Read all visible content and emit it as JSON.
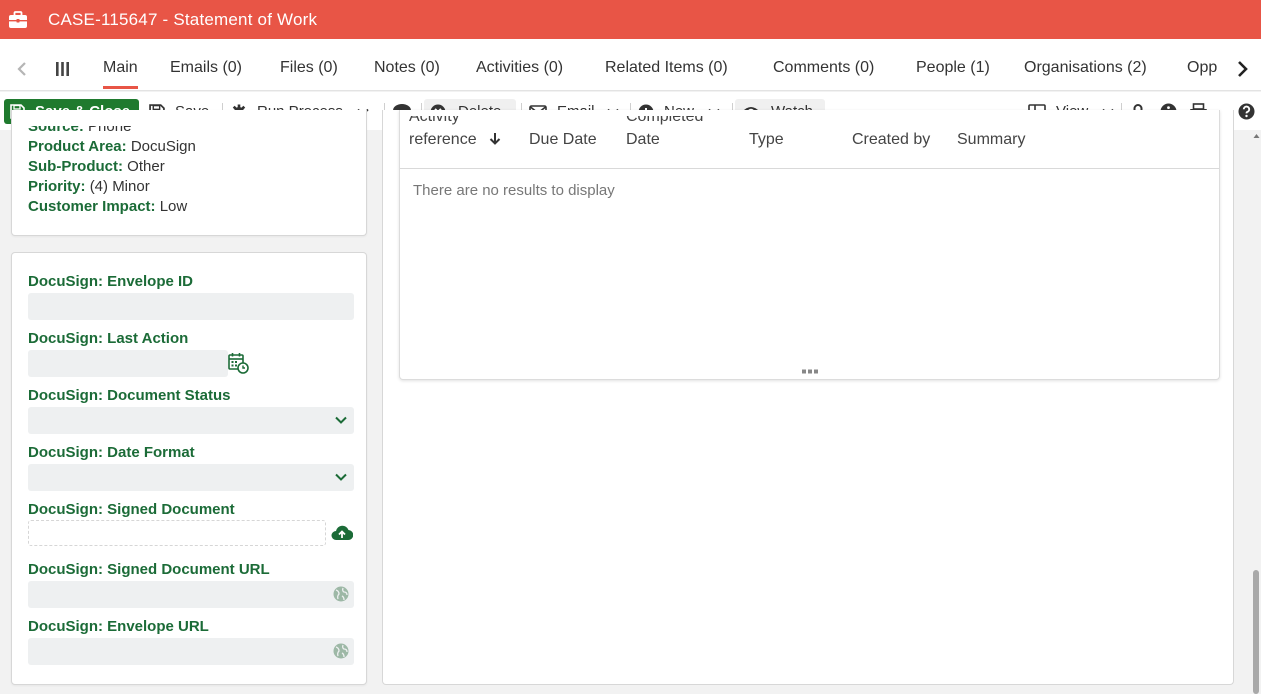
{
  "window": {
    "title": "CASE-115647 - Statement of Work",
    "title_icon": "briefcase-icon",
    "accent_color": "#e85546"
  },
  "tabs": [
    {
      "label": "Main",
      "active": true
    },
    {
      "label": "Emails (0)"
    },
    {
      "label": "Files (0)"
    },
    {
      "label": "Notes (0)"
    },
    {
      "label": "Activities (0)"
    },
    {
      "label": "Related Items (0)"
    },
    {
      "label": "Comments (0)"
    },
    {
      "label": "People (1)"
    },
    {
      "label": "Organisations (2)"
    },
    {
      "label": "Opp"
    }
  ],
  "toolbar": {
    "save_close": "Save & Close",
    "save": "Save",
    "run_process": "Run Process",
    "delete": "Delete",
    "email": "Email",
    "new": "New",
    "watch": "Watch",
    "view": "View",
    "primary_color": "#1f7a2e"
  },
  "case_details": {
    "source": {
      "label": "Source:",
      "value": "Phone"
    },
    "product_area": {
      "label": "Product Area:",
      "value": "DocuSign"
    },
    "sub_product": {
      "label": "Sub-Product:",
      "value": "Other"
    },
    "priority": {
      "label": "Priority:",
      "value": "(4) Minor"
    },
    "customer_impact": {
      "label": "Customer Impact:",
      "value": "Low"
    }
  },
  "docusign_fields": {
    "envelope_id": {
      "label": "DocuSign: Envelope ID",
      "value": ""
    },
    "last_action": {
      "label": "DocuSign: Last Action",
      "value": ""
    },
    "document_status": {
      "label": "DocuSign: Document Status",
      "value": ""
    },
    "date_format": {
      "label": "DocuSign: Date Format",
      "value": ""
    },
    "signed_document": {
      "label": "DocuSign: Signed Document",
      "value": ""
    },
    "signed_document_url": {
      "label": "DocuSign: Signed Document URL",
      "value": ""
    },
    "envelope_url": {
      "label": "DocuSign: Envelope URL",
      "value": ""
    }
  },
  "activities_grid": {
    "columns": [
      {
        "line1": "Activity",
        "line2": "reference",
        "sorted": "desc"
      },
      {
        "line1": "Due Date",
        "line2": ""
      },
      {
        "line1": "Completed",
        "line2": "Date"
      },
      {
        "line1": "Type",
        "line2": ""
      },
      {
        "line1": "Created by",
        "line2": ""
      },
      {
        "line1": "Summary",
        "line2": ""
      }
    ],
    "empty_message": "There are no results to display"
  }
}
